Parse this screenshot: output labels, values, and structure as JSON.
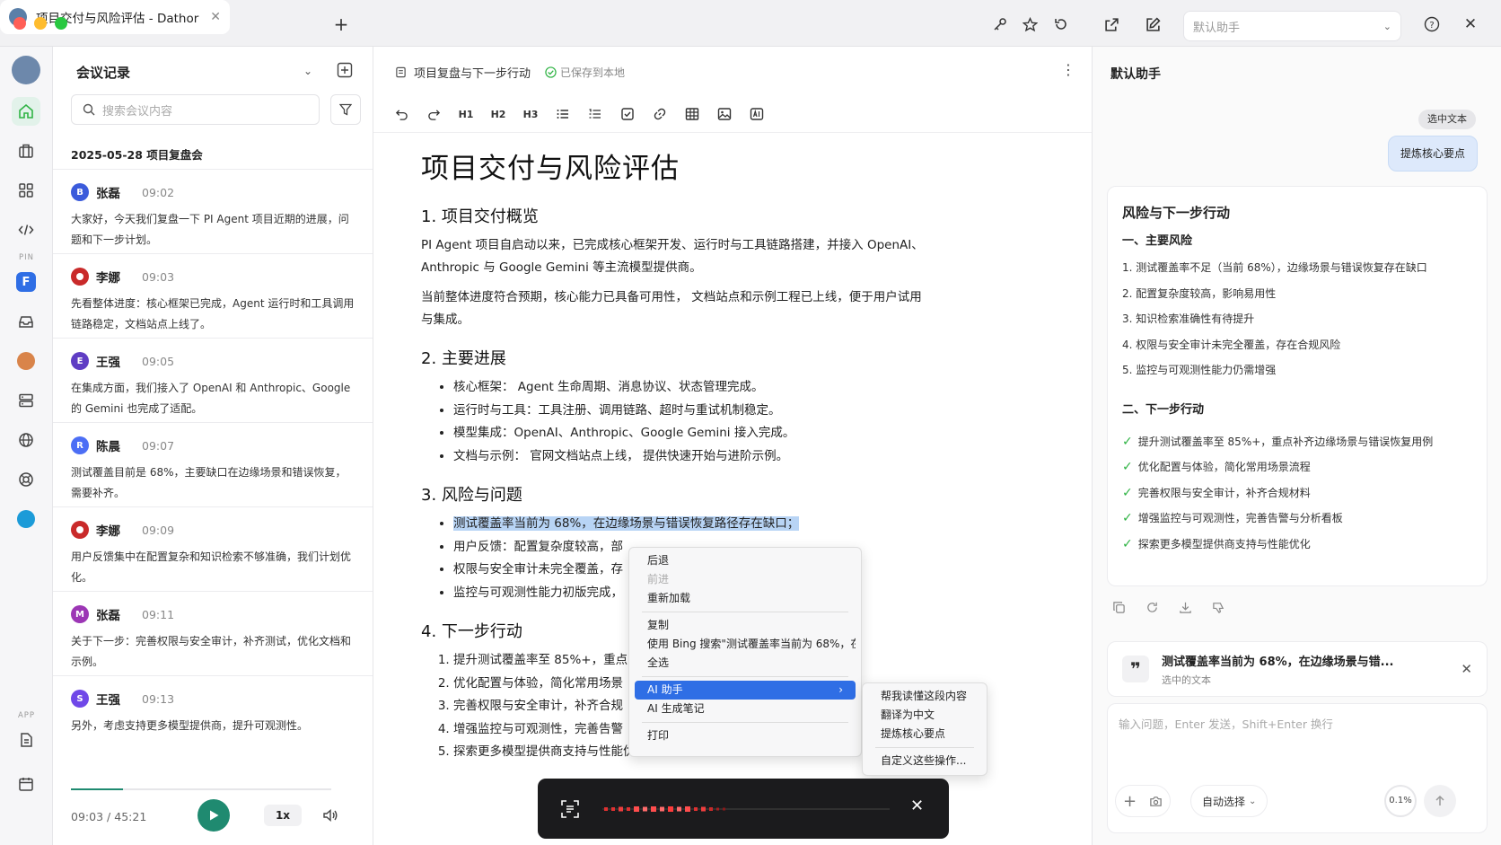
{
  "window": {
    "tab_title": "项目交付与风险评估 - Dathor",
    "assistant_select": "默认助手"
  },
  "rail": {
    "pin_label": "PIN",
    "app_label": "APP",
    "pin_f_label": "F"
  },
  "list": {
    "title": "会议记录",
    "search_placeholder": "搜索会议内容",
    "meeting_title": "2025-05-28  项目复盘会",
    "messages": [
      {
        "initial": "B",
        "name": "张磊",
        "time": "09:02",
        "text": "大家好，今天我们复盘一下 PI Agent 项目近期的进展，问题和下一步计划。",
        "color": "#3b5bdb"
      },
      {
        "initial": "",
        "name": "李娜",
        "time": "09:03",
        "text": "先看整体进度：核心框架已完成，Agent 运行时和工具调用链路稳定，文档站点上线了。",
        "color": "#c92a2a"
      },
      {
        "initial": "E",
        "name": "王强",
        "time": "09:05",
        "text": "在集成方面，我们接入了 OpenAI 和 Anthropic、Google 的 Gemini 也完成了适配。",
        "color": "#5f3dc4"
      },
      {
        "initial": "R",
        "name": "陈晨",
        "time": "09:07",
        "text": "测试覆盖目前是 68%，主要缺口在边缘场景和错误恢复，需要补齐。",
        "color": "#4c6ef5"
      },
      {
        "initial": "",
        "name": "李娜",
        "time": "09:09",
        "text": "用户反馈集中在配置复杂和知识检索不够准确，我们计划优化。",
        "color": "#c92a2a"
      },
      {
        "initial": "M",
        "name": "张磊",
        "time": "09:11",
        "text": "关于下一步：完善权限与安全审计，补齐测试，优化文档和示例。",
        "color": "#9c36b5"
      },
      {
        "initial": "S",
        "name": "王强",
        "time": "09:13",
        "text": "另外，考虑支持更多模型提供商，提升可观测性。",
        "color": "#7048e8"
      }
    ],
    "player": {
      "current": "09:03",
      "separator": "/",
      "total": "45:21",
      "speed": "1x",
      "progress": 0.2
    }
  },
  "editor": {
    "doc_name": "项目复盘与下一步行动",
    "saved_status": "已保存到本地",
    "toolbar": {
      "h1": "H1",
      "h2": "H2",
      "h3": "H3"
    },
    "title": "项目交付与风险评估",
    "s1_heading": "1. 项目交付概览",
    "s1_p1": "PI Agent 项目自启动以来，已完成核心框架开发、运行时与工具链路搭建，并接入 OpenAI、Anthropic 与 Google Gemini 等主流模型提供商。",
    "s1_p2": "当前整体进度符合预期，核心能力已具备可用性， 文档站点和示例工程已上线，便于用户试用与集成。",
    "s2_heading": "2. 主要进展",
    "s2_items": [
      "核心框架： Agent 生命周期、消息协议、状态管理完成。",
      "运行时与工具：工具注册、调用链路、超时与重试机制稳定。",
      "模型集成：OpenAI、Anthropic、Google Gemini 接入完成。",
      "文档与示例： 官网文档站点上线， 提供快速开始与进阶示例。"
    ],
    "s3_heading": "3. 风险与问题",
    "s3_items": [
      "测试覆盖率当前为 68%，在边缘场景与错误恢复路径存在缺口；",
      "用户反馈：配置复杂度较高，部",
      "权限与安全审计未完全覆盖，存",
      "监控与可观测性能力初版完成，"
    ],
    "s4_heading": "4. 下一步行动",
    "s4_items": [
      "提升测试覆盖率至 85%+，重点",
      "优化配置与体验，简化常用场景",
      "完善权限与安全审计，补齐合规",
      "增强监控与可观测性，完善告警",
      "探索更多模型提供商支持与性能优化。"
    ]
  },
  "context_menu": {
    "back": "后退",
    "forward": "前进",
    "reload": "重新加载",
    "copy": "复制",
    "bing_search": "使用 Bing 搜索\"测试覆盖率当前为 68%，在...",
    "select_all": "全选",
    "ai_assistant": "AI 助手",
    "ai_notes": "AI 生成笔记",
    "print": "打印",
    "sub_items": [
      "帮我读懂这段内容",
      "翻译为中文",
      "提炼核心要点"
    ],
    "sub_custom": "自定义这些操作..."
  },
  "assistant": {
    "title": "默认助手",
    "selected_tag": "选中文本",
    "user_query": "提炼核心要点",
    "card_title": "风险与下一步行动",
    "risks_heading": "一、主要风险",
    "risks": [
      "1.  测试覆盖率不足（当前 68%），边缘场景与错误恢复存在缺口",
      "2.  配置复杂度较高，影响易用性",
      "3.  知识检索准确性有待提升",
      "4.  权限与安全审计未完全覆盖，存在合规风险",
      "5.  监控与可观测性能力仍需增强"
    ],
    "actions_heading": "二、下一步行动",
    "actions": [
      "提升测试覆盖率至 85%+，重点补齐边缘场景与错误恢复用例",
      "优化配置与体验，简化常用场景流程",
      "完善权限与安全审计，补齐合规材料",
      "增强监控与可观测性，完善告警与分析看板",
      "探索更多模型提供商支持与性能优化"
    ],
    "quote_text": "测试覆盖率当前为 68%，在边缘场景与错...",
    "quote_sub": "选中的文本",
    "input_placeholder": "输入问题，Enter 发送，Shift+Enter 换行",
    "auto_select": "自动选择",
    "usage": "0.1%"
  },
  "colors": {
    "accent": "#2f6ee5",
    "green": "#2fb344",
    "play": "#1f8a70"
  }
}
